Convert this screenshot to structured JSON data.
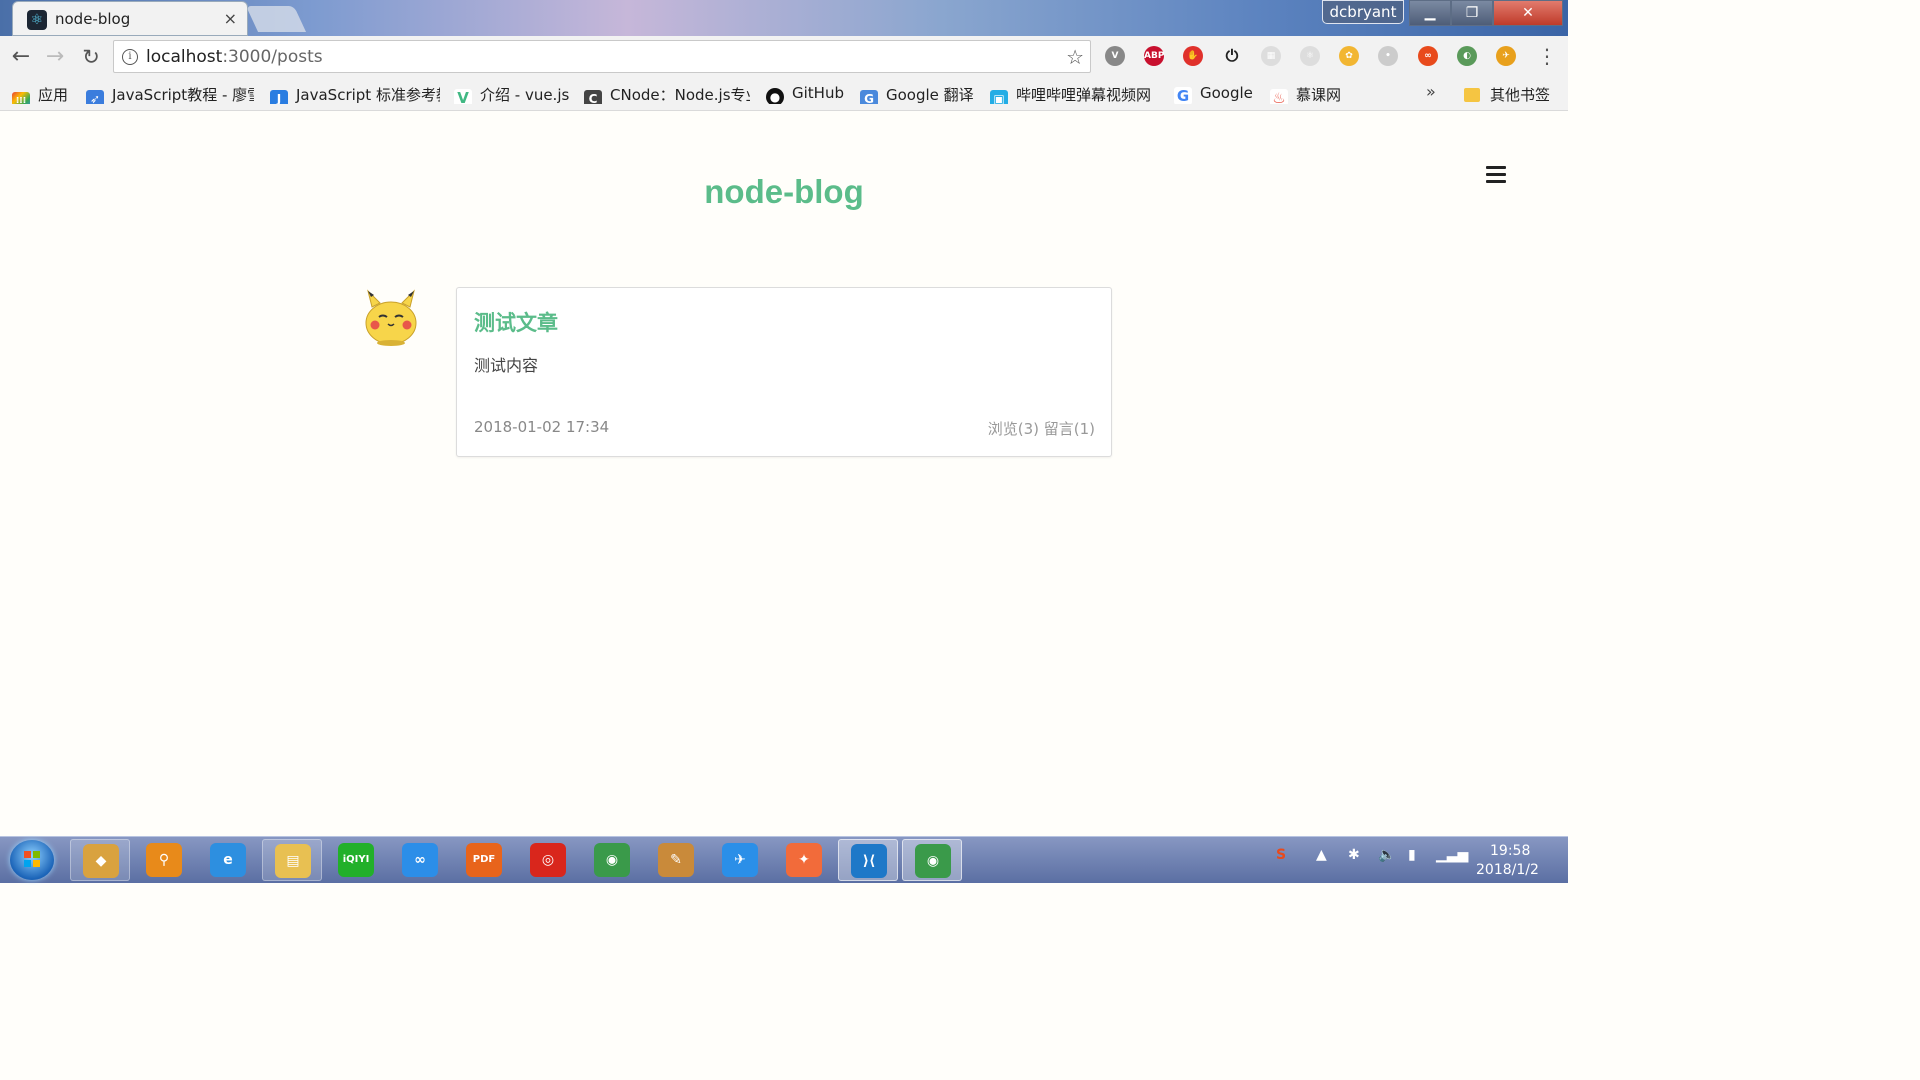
{
  "browser": {
    "tab_title": "node-blog",
    "tab_close": "×",
    "user_name": "dcbryant",
    "url_host": "localhost",
    "url_path": ":3000/posts",
    "window_min": "▁",
    "window_max": "❐",
    "window_close": "✕",
    "menu_icon": "⋮"
  },
  "bookmarks": {
    "items": [
      {
        "label": "应用",
        "icon": "apps-grid-icon",
        "color": "#e94235"
      },
      {
        "label": "JavaScript教程 - 廖雪",
        "icon": "rocket-icon",
        "color": "#3b7ddd"
      },
      {
        "label": "JavaScript 标准参考教",
        "icon": "j-icon",
        "color": "#2a7de1"
      },
      {
        "label": "介绍 - vue.js",
        "icon": "vue-icon",
        "color": "#41b883"
      },
      {
        "label": "CNode：Node.js专业",
        "icon": "cnode-icon",
        "color": "#444444"
      },
      {
        "label": "GitHub",
        "icon": "github-icon",
        "color": "#111111"
      },
      {
        "label": "Google 翻译",
        "icon": "translate-icon",
        "color": "#4a89dc"
      },
      {
        "label": "哔哩哔哩弹幕视频网",
        "icon": "bilibili-icon",
        "color": "#23ade5"
      },
      {
        "label": "Google",
        "icon": "google-icon",
        "color": "#4285f4"
      },
      {
        "label": "慕课网",
        "icon": "flame-icon",
        "color": "#e74c3c"
      }
    ],
    "more": "»",
    "other": "其他书签"
  },
  "page": {
    "site_title": "node-blog",
    "post": {
      "title": "测试文章",
      "content": "测试内容",
      "date": "2018-01-02 17:34",
      "stats": "浏览(3) 留言(1)"
    }
  },
  "taskbar": {
    "apps": [
      {
        "name": "app-unknown",
        "color": "#d9a23f",
        "glyph": "◆"
      },
      {
        "name": "search-app",
        "color": "#e88a1a",
        "glyph": "⚲"
      },
      {
        "name": "internet-explorer",
        "color": "#2d8fe0",
        "glyph": "e"
      },
      {
        "name": "file-explorer",
        "color": "#e8c052",
        "glyph": "▤"
      },
      {
        "name": "iqiyi",
        "color": "#22b02a",
        "glyph": "iQIYI"
      },
      {
        "name": "baidu-netdisk",
        "color": "#2c8ee8",
        "glyph": "∞"
      },
      {
        "name": "pdf-reader",
        "color": "#e8641b",
        "glyph": "PDF"
      },
      {
        "name": "netease-music",
        "color": "#d9261c",
        "glyph": "◎"
      },
      {
        "name": "chrome",
        "color": "#3a9a4a",
        "glyph": "◉"
      },
      {
        "name": "paint",
        "color": "#c98a3a",
        "glyph": "✎"
      },
      {
        "name": "feishu",
        "color": "#2b8fe8",
        "glyph": "✈"
      },
      {
        "name": "postman",
        "color": "#f26b3a",
        "glyph": "✦"
      },
      {
        "name": "vscode",
        "color": "#1e78c8",
        "glyph": "⟩⟨"
      },
      {
        "name": "chrome-active",
        "color": "#3a9a4a",
        "glyph": "◉"
      }
    ],
    "time": "19:58",
    "date": "2018/1/2"
  }
}
